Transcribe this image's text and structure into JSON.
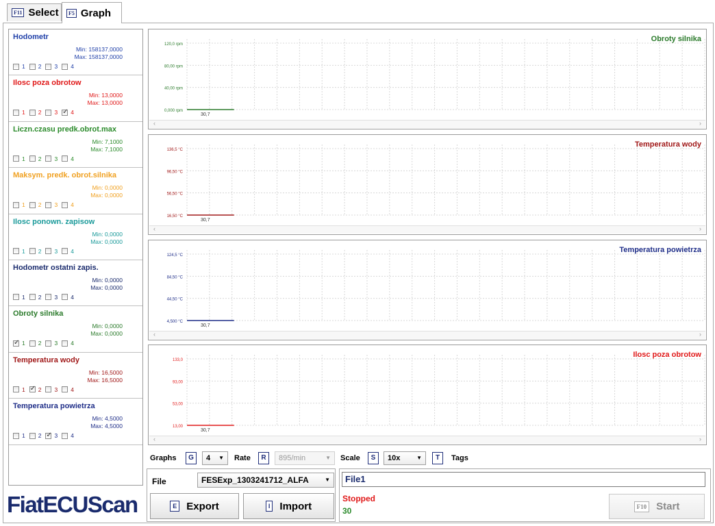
{
  "tabs": [
    {
      "key": "F11",
      "label": "Select"
    },
    {
      "key": "F5",
      "label": "Graph"
    }
  ],
  "parameters": [
    {
      "name": "Hodometr",
      "min": "Min: 158137,0000",
      "max": "Max: 158137,0000",
      "color": "#1f3fa8",
      "checked": []
    },
    {
      "name": "Ilosc poza obrotow",
      "min": "Min: 13,0000",
      "max": "Max: 13,0000",
      "color": "#e01818",
      "checked": [
        4
      ]
    },
    {
      "name": "Liczn.czasu predk.obrot.max",
      "min": "Min: 7,1000",
      "max": "Max: 7,1000",
      "color": "#2a8a2a",
      "checked": []
    },
    {
      "name": "Maksym. predk. obrot.silnika",
      "min": "Min: 0,0000",
      "max": "Max: 0,0000",
      "color": "#f0a020",
      "checked": []
    },
    {
      "name": "Ilosc ponown. zapisow",
      "min": "Min: 0,0000",
      "max": "Max: 0,0000",
      "color": "#1a9a9a",
      "checked": []
    },
    {
      "name": "Hodometr ostatni zapis.",
      "min": "Min: 0,0000",
      "max": "Max: 0,0000",
      "color": "#1a2b6d",
      "checked": []
    },
    {
      "name": "Obroty silnika",
      "min": "Min: 0,0000",
      "max": "Max: 0,0000",
      "color": "#2a7a2a",
      "checked": [
        1
      ]
    },
    {
      "name": "Temperatura wody",
      "min": "Min: 16,5000",
      "max": "Max: 16,5000",
      "color": "#a01818",
      "checked": [
        2
      ]
    },
    {
      "name": "Temperatura powietrza",
      "min": "Min: 4,5000",
      "max": "Max: 4,5000",
      "color": "#1f2e88",
      "checked": [
        3
      ]
    }
  ],
  "checkbox_labels": [
    "1",
    "2",
    "3",
    "4"
  ],
  "chart_data": [
    {
      "type": "line",
      "title": "Obroty silnika",
      "color": "#2a7a2a",
      "y_ticks": [
        "120,0 rpm",
        "80,00 rpm",
        "40,00 rpm",
        "0,000 rpm"
      ],
      "x_tick": "30,7",
      "x": [
        0,
        30.7
      ],
      "y": [
        0,
        0
      ],
      "ylim": [
        0,
        120
      ]
    },
    {
      "type": "line",
      "title": "Temperatura wody",
      "color": "#a01818",
      "y_ticks": [
        "136,5 °C",
        "96,50 °C",
        "56,50 °C",
        "16,50 °C"
      ],
      "x_tick": "30,7",
      "x": [
        0,
        30.7
      ],
      "y": [
        16.5,
        16.5
      ],
      "ylim": [
        16.5,
        136.5
      ]
    },
    {
      "type": "line",
      "title": "Temperatura powietrza",
      "color": "#1f2e88",
      "y_ticks": [
        "124,5 °C",
        "84,50 °C",
        "44,50 °C",
        "4,500 °C"
      ],
      "x_tick": "30,7",
      "x": [
        0,
        30.7
      ],
      "y": [
        4.5,
        4.5
      ],
      "ylim": [
        4.5,
        124.5
      ]
    },
    {
      "type": "line",
      "title": "Ilosc poza obrotow",
      "color": "#e01818",
      "y_ticks": [
        "133,0",
        "93,00",
        "53,00",
        "13,00"
      ],
      "x_tick": "30,7",
      "x": [
        0,
        30.7
      ],
      "y": [
        13,
        13
      ],
      "ylim": [
        13,
        133
      ]
    }
  ],
  "controls": {
    "graphs_label": "Graphs",
    "graphs_key": "G",
    "graphs_value": "4",
    "rate_label": "Rate",
    "rate_key": "R",
    "rate_value": "895/min",
    "scale_label": "Scale",
    "scale_key": "S",
    "scale_value": "10x",
    "tags_key": "T",
    "tags_label": "Tags"
  },
  "file": {
    "label": "File",
    "value": "FESExp_1303241712_ALFA"
  },
  "export": {
    "key": "E",
    "label": "Export"
  },
  "import": {
    "key": "I",
    "label": "Import"
  },
  "status": {
    "filename": "File1",
    "state": "Stopped",
    "count": "30",
    "state_color": "#e01818",
    "count_color": "#2a8a2a"
  },
  "start": {
    "key": "F10",
    "label": "Start"
  },
  "logo": "FiatECUScan"
}
